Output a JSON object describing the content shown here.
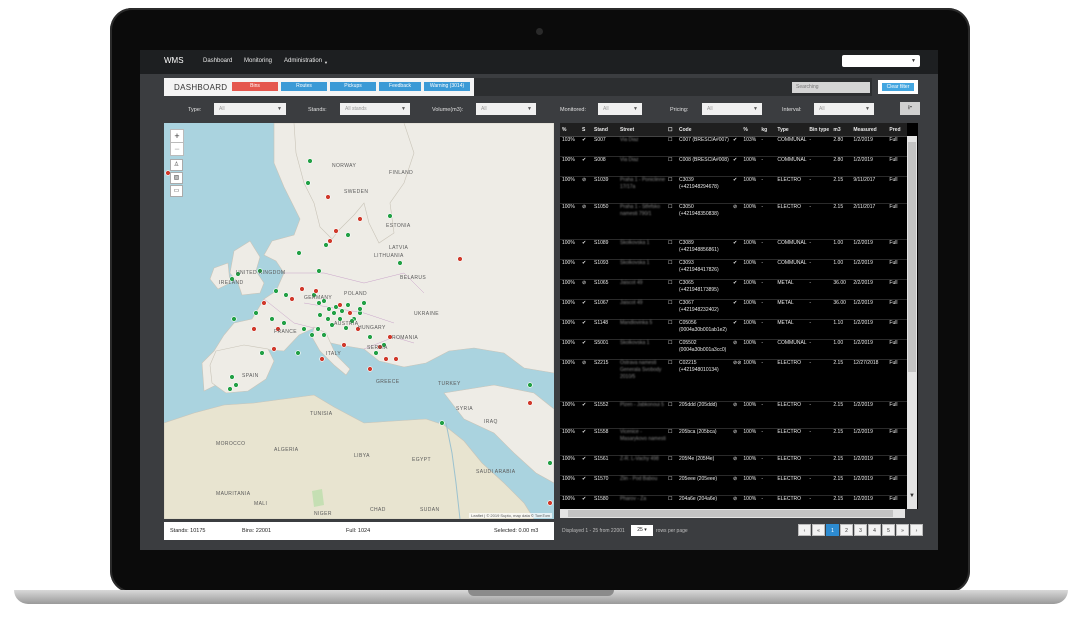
{
  "nav": {
    "brand": "WMS",
    "items": [
      "Dashboard",
      "Monitoring",
      "Administration"
    ],
    "user_select": ""
  },
  "dashboard": {
    "title": "DASHBOARD",
    "pills": [
      {
        "label": "Bins",
        "color": "#e5574e"
      },
      {
        "label": "Routes",
        "color": "#3b9ad6"
      },
      {
        "label": "Pickups",
        "color": "#3b9ad6"
      },
      {
        "label": "Feedback",
        "color": "#3b9ad6"
      },
      {
        "label": "Warning (3014)",
        "color": "#3b9ad6"
      }
    ],
    "search_placeholder": "Searching",
    "clear_button": "Clear filter"
  },
  "filters": [
    {
      "label": "Type:",
      "value": "All"
    },
    {
      "label": "Stands:",
      "value": "All stands"
    },
    {
      "label": "Volume(m3):",
      "value": "All"
    },
    {
      "label": "Monitored:",
      "value": "All"
    },
    {
      "label": "Pricing:",
      "value": "All"
    },
    {
      "label": "Interval:",
      "value": "All"
    }
  ],
  "map": {
    "labels": [
      "NORWAY",
      "FINLAND",
      "SWEDEN",
      "ESTONIA",
      "LATVIA",
      "LITHUANIA",
      "BELARUS",
      "UNITED KINGDOM",
      "IRELAND",
      "GERMANY",
      "POLAND",
      "UKRAINE",
      "FRANCE",
      "AUSTRIA",
      "HUNGARY",
      "ROMANIA",
      "ITALY",
      "SERBIA",
      "SPAIN",
      "GREECE",
      "TURKEY",
      "TUNISIA",
      "SYRIA",
      "IRAQ",
      "MOROCCO",
      "ALGERIA",
      "LIBYA",
      "EGYPT",
      "SAUDI ARABIA",
      "MAURITANIA",
      "MALI",
      "NIGER",
      "CHAD",
      "SUDAN"
    ],
    "attribution": "Leaflet | © 2019 Supto, map data © TomTom",
    "green_marker_color": "#22a045",
    "red_marker_color": "#d0392b"
  },
  "map_footer": {
    "stands": "Stands: 10175",
    "bins": "Bins: 22001",
    "full": "Full: 1024",
    "selected": "Selected: 0.00 m3"
  },
  "table": {
    "headers": [
      "%",
      "S",
      "Stand",
      "Street",
      "",
      "Code",
      "",
      "%",
      "kg",
      "Type",
      "Bin type",
      "m3",
      "Measured",
      "Pred"
    ],
    "rows": [
      [
        "103%",
        "✔",
        "S007",
        "Via Diaz",
        "☐",
        "C007 (BRESCIA#007)",
        "✔",
        "103%",
        "-",
        "COMMUNAL",
        "-",
        "2.80",
        "1/2/2019",
        "Full"
      ],
      [
        "100%",
        "✔",
        "S008",
        "Via Diaz",
        "☐",
        "C008 (BRESCIA#008)",
        "✔",
        "100%",
        "-",
        "COMMUNAL",
        "-",
        "2.80",
        "1/2/2019",
        "Full"
      ],
      [
        "100%",
        "⊘",
        "S1039",
        "Praha 1 - Poniclinne 17/17a",
        "☐",
        "C3039 (+421948294678)",
        "✔",
        "100%",
        "-",
        "ELECTRO",
        "-",
        "2.15",
        "9/11/2017",
        "Full"
      ],
      [
        "100%",
        "⊘",
        "S1050",
        "Praha 1 - Stfefsko namesti 790/1",
        "☐",
        "C3050 (+421948350838)",
        "⊘",
        "100%",
        "-",
        "ELECTRO",
        "-",
        "2.15",
        "2/11/2017",
        "Full"
      ],
      [
        "100%",
        "✔",
        "S1089",
        "Skolkovska 1",
        "☐",
        "C3089 (+421948856861)",
        "✔",
        "100%",
        "-",
        "COMMUNAL",
        "-",
        "1.00",
        "1/2/2019",
        "Full"
      ],
      [
        "100%",
        "✔",
        "S1093",
        "Skolkovska 1",
        "☐",
        "C3093 (+421948417826)",
        "✔",
        "100%",
        "-",
        "COMMUNAL",
        "-",
        "1.00",
        "1/2/2019",
        "Full"
      ],
      [
        "100%",
        "⊘",
        "S1065",
        "Jaiscot 49",
        "☐",
        "C3065 (+421948173895)",
        "✔",
        "100%",
        "-",
        "METAL",
        "-",
        "36.00",
        "2/2/2019",
        "Full"
      ],
      [
        "100%",
        "✔",
        "S1067",
        "Jaiscot 49",
        "☐",
        "C3067 (+421948232402)",
        "✔",
        "100%",
        "-",
        "METAL",
        "-",
        "36.00",
        "1/2/2019",
        "Full"
      ],
      [
        "100%",
        "✔",
        "S1148",
        "Mandlovinka 5",
        "☐",
        "C05056 (0004a30b001ab1e2)",
        "✔",
        "100%",
        "-",
        "METAL",
        "-",
        "1.10",
        "1/2/2019",
        "Full"
      ],
      [
        "100%",
        "✔",
        "S5001",
        "Skolkovska 1",
        "☐",
        "C05502 (0004a30b001a3cc0)",
        "⊘",
        "100%",
        "-",
        "COMMUNAL",
        "-",
        "1.00",
        "1/2/2019",
        "Full"
      ],
      [
        "100%",
        "⊘",
        "S2215",
        "Ostrava namesti Generala Svobody 2010/5",
        "☐",
        "C02215 (+421948010134)",
        "⊘⊘",
        "100%",
        "-",
        "ELECTRO",
        "-",
        "2.15",
        "12/27/2018",
        "Full"
      ],
      [
        "100%",
        "✔",
        "S1552",
        "Plzen - Jabkonoui 5",
        "☐",
        "205ddd (205ddd)",
        "⊘",
        "100%",
        "-",
        "ELECTRO",
        "-",
        "2.15",
        "1/2/2019",
        "Full"
      ],
      [
        "100%",
        "✔",
        "S1558",
        "Vicenice - Masarykovo namesti",
        "☐",
        "205bca (205bca)",
        "⊘",
        "100%",
        "-",
        "ELECTRO",
        "-",
        "2.15",
        "1/2/2019",
        "Full"
      ],
      [
        "100%",
        "✔",
        "S1561",
        "Z-R. L-Vachy 498",
        "☐",
        "205f4e (205f4e)",
        "⊘",
        "100%",
        "-",
        "ELECTRO",
        "-",
        "2.15",
        "1/2/2019",
        "Full"
      ],
      [
        "100%",
        "✔",
        "S1570",
        "Zlin - Pod Babou",
        "☐",
        "205eee (205eee)",
        "⊘",
        "100%",
        "-",
        "ELECTRO",
        "-",
        "2.15",
        "1/2/2019",
        "Full"
      ],
      [
        "100%",
        "✔",
        "S1580",
        "Pharov - Za",
        "☐",
        "204a6e (204a6e)",
        "⊘",
        "100%",
        "-",
        "ELECTRO",
        "-",
        "2.15",
        "1/2/2019",
        "Full"
      ]
    ]
  },
  "pagination": {
    "displayed": "Displayed 1 - 25 from 22001",
    "per_page": "25",
    "per_page_label": "rows per page",
    "pages": [
      "‹",
      "«",
      "1",
      "2",
      "3",
      "4",
      "5",
      "»",
      "›"
    ],
    "active_page": "1"
  }
}
